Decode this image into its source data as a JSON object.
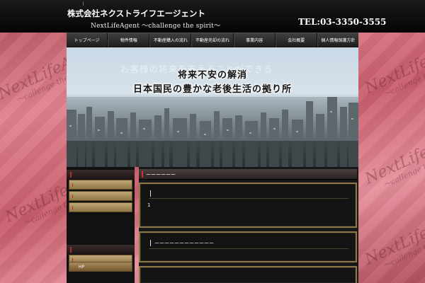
{
  "header": {
    "company": "株式会社ネクストライフエージェント",
    "tagline": "NextLifeAgent 〜challenge the spirit〜",
    "phone": "TEL:03-3350-3555"
  },
  "nav": {
    "items": [
      {
        "label": "トップページ"
      },
      {
        "label": "物件情報"
      },
      {
        "label": "不動産購入の流れ"
      },
      {
        "label": "不動産売却の流れ"
      },
      {
        "label": "事業内容"
      },
      {
        "label": "会社概要"
      },
      {
        "label": "個人情報保護方針"
      }
    ]
  },
  "hero": {
    "ghost_text": "お客様の将来を支えることができる",
    "line1": "将来不安の解消",
    "line2": "日本国民の豊かな老後生活の拠り所"
  },
  "sidebar": {
    "items": [
      {
        "label": ""
      },
      {
        "label": ""
      },
      {
        "label": ""
      }
    ],
    "hp_label": "HP"
  },
  "main": {
    "section_title": "ーーーーーー",
    "panel1_text": "1",
    "panel2_title": "ーーーーーーーーーーーー"
  },
  "watermark": {
    "name": "NextLifeAgent",
    "sub": "〜callenge the spirit〜"
  },
  "colors": {
    "accent_red": "#e02b32",
    "gold": "#8c7747",
    "background_pink": "#d8727f"
  }
}
